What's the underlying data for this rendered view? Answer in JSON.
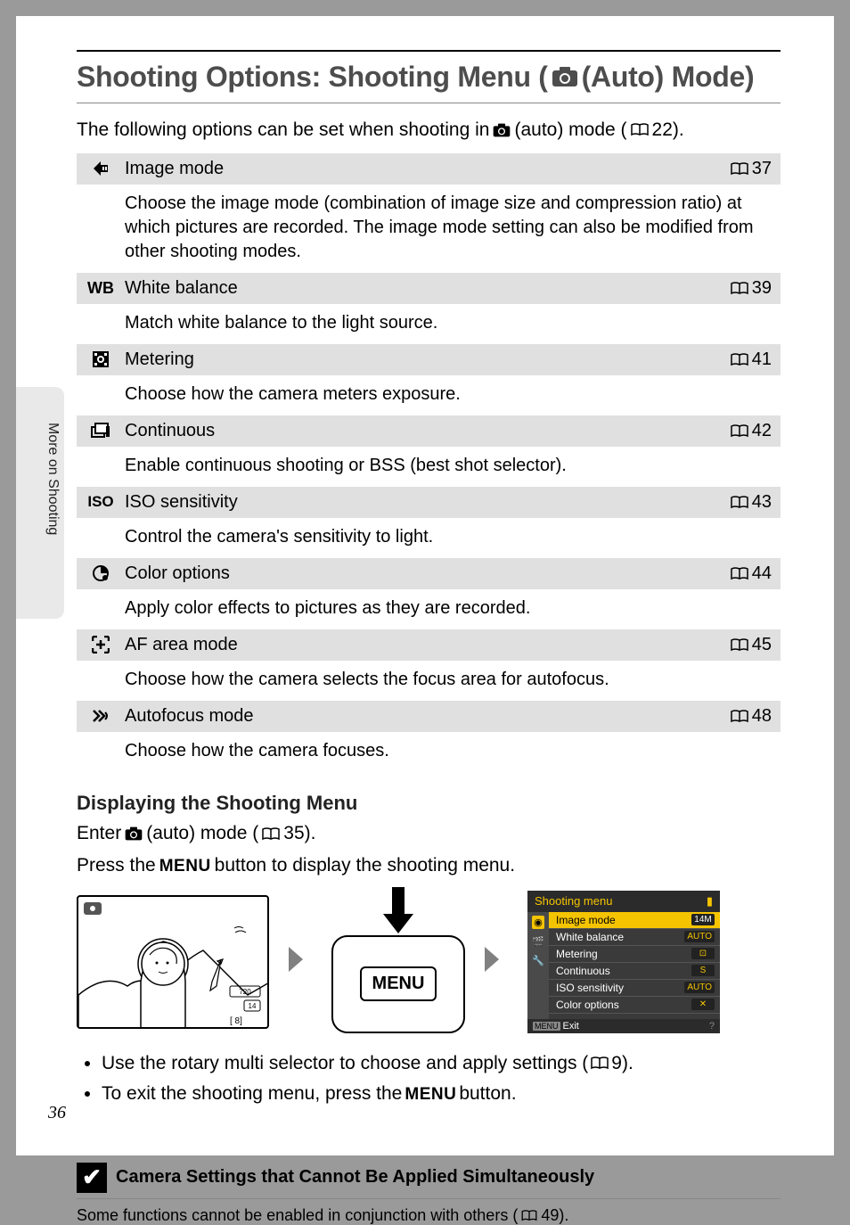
{
  "sideLabel": "More on Shooting",
  "title": {
    "pre": "Shooting Options: Shooting Menu (",
    "post": " (Auto) Mode)"
  },
  "intro": {
    "a": "The following options can be set when shooting in ",
    "b": " (auto) mode (",
    "c": " 22)."
  },
  "options": [
    {
      "title": "Image mode",
      "page": "37",
      "desc": "Choose the image mode (combination of image size and compression ratio) at which pictures are recorded. The image mode setting can also be modified from other shooting modes."
    },
    {
      "title": "White balance",
      "page": "39",
      "desc": "Match white balance to the light source."
    },
    {
      "title": "Metering",
      "page": "41",
      "desc": "Choose how the camera meters exposure."
    },
    {
      "title": "Continuous",
      "page": "42",
      "desc": "Enable continuous shooting or BSS (best shot selector)."
    },
    {
      "title": "ISO sensitivity",
      "page": "43",
      "desc": "Control the camera's sensitivity to light."
    },
    {
      "title": "Color options",
      "page": "44",
      "desc": "Apply color effects to pictures as they are recorded."
    },
    {
      "title": "AF area mode",
      "page": "45",
      "desc": "Choose how the camera selects the focus area for autofocus."
    },
    {
      "title": "Autofocus mode",
      "page": "48",
      "desc": "Choose how the camera focuses."
    }
  ],
  "subhead": "Displaying the Shooting Menu",
  "enter": {
    "a": "Enter ",
    "b": " (auto) mode (",
    "c": " 35)."
  },
  "press": {
    "a": "Press the ",
    "menu": "MENU",
    "b": " button to display the shooting menu."
  },
  "menuBtn": "MENU",
  "menuScreen": {
    "title": "Shooting menu",
    "items": [
      {
        "label": "Image mode",
        "val": "14M"
      },
      {
        "label": "White balance",
        "val": "AUTO"
      },
      {
        "label": "Metering",
        "val": "⊡"
      },
      {
        "label": "Continuous",
        "val": "S"
      },
      {
        "label": "ISO sensitivity",
        "val": "AUTO"
      },
      {
        "label": "Color options",
        "val": "✕"
      }
    ],
    "exit": "Exit"
  },
  "bullets": {
    "b1a": "Use the rotary multi selector to choose and apply settings (",
    "b1b": " 9).",
    "b2a": "To exit the shooting menu, press the ",
    "b2menu": "MENU",
    "b2b": " button."
  },
  "note": {
    "title": "Camera Settings that Cannot Be Applied Simultaneously",
    "a": "Some functions cannot be enabled in conjunction with others (",
    "b": " 49)."
  },
  "pageNum": "36"
}
